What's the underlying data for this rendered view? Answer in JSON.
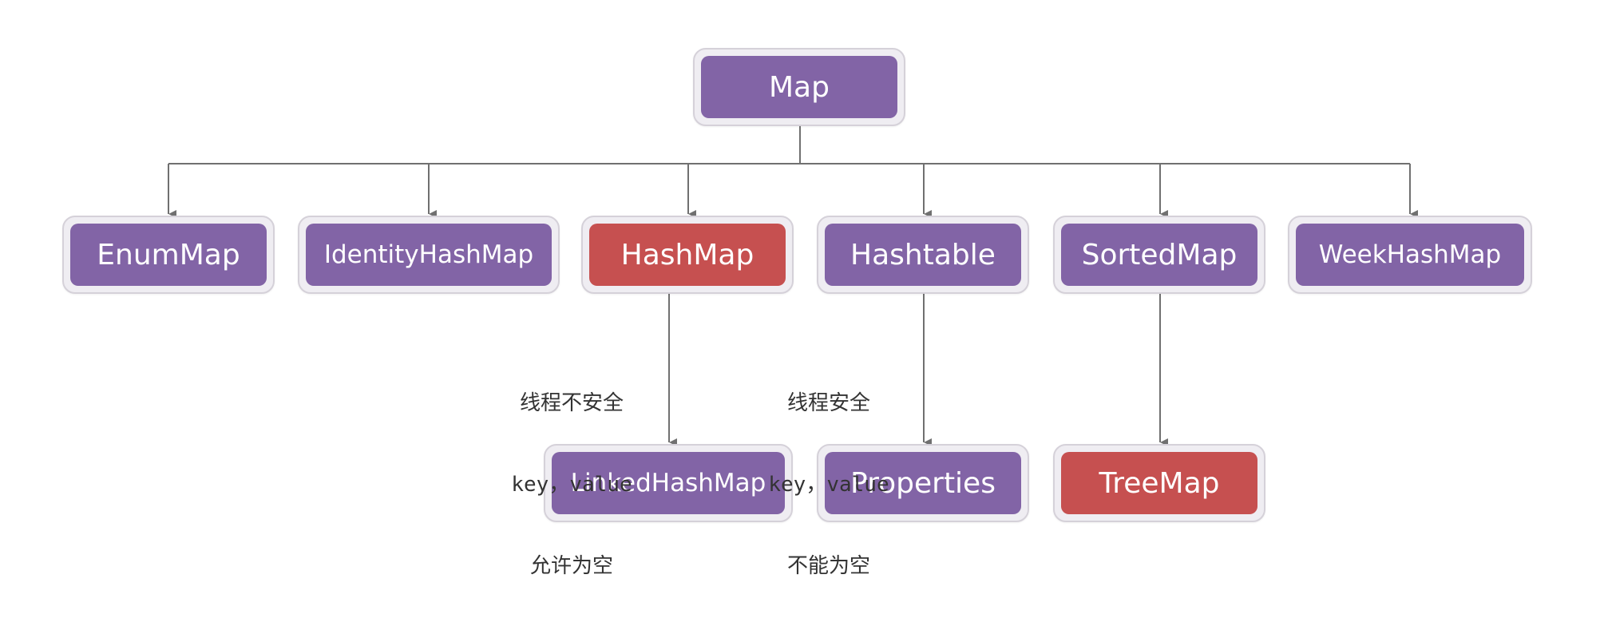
{
  "colors": {
    "node_purple": "#8264a6",
    "node_red": "#c65050",
    "node_frame": "#efedf2",
    "connector": "#707070",
    "text_white": "#ffffff"
  },
  "nodes": {
    "map": "Map",
    "enummap": "EnumMap",
    "identityhashmap": "IdentityHashMap",
    "hashmap": "HashMap",
    "hashtable": "Hashtable",
    "sortedmap": "SortedMap",
    "weekhashmap": "WeekHashMap",
    "linkedhashmap": "LinkedHashMap",
    "properties": "Properties",
    "treemap": "TreeMap"
  },
  "notes": {
    "hashmap_note": {
      "line1": "线程不安全",
      "line2": "key，value",
      "line3": "允许为空"
    },
    "hashtable_note": {
      "line1": "线程安全",
      "line2": "key，value",
      "line3": "不能为空"
    }
  }
}
